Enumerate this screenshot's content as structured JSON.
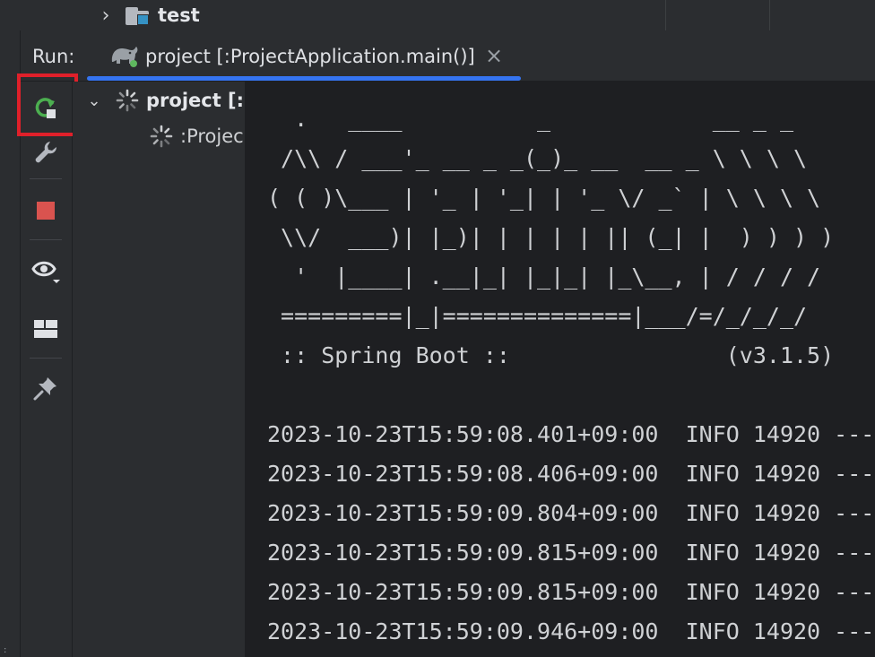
{
  "project_tree": {
    "folder_label": "test",
    "folder_icon": "folder-test-icon"
  },
  "run_panel": {
    "run_label": "Run:",
    "tab_label": "project [:ProjectApplication.main()]",
    "tab_close": "×",
    "tab_icon": "gradle-elephant-icon"
  },
  "toolbar": {
    "buttons": [
      "rerun-icon",
      "wrench-icon",
      "stop-icon",
      "eye-icon",
      "layout-icon",
      "pin-icon"
    ],
    "stop_color": "#d9534f",
    "rerun_color": "#4caf50",
    "highlight_color": "#e0202a"
  },
  "tree": {
    "root_label": "project [:l",
    "child_label": ":Projec"
  },
  "console": {
    "banner": [
      "  .   ____          _            __ _ _",
      " /\\\\ / ___'_ __ _ _(_)_ __  __ _ \\ \\ \\ \\",
      "( ( )\\___ | '_ | '_| | '_ \\/ _` | \\ \\ \\ \\",
      " \\\\/  ___)| |_)| | | | | || (_| |  ) ) ) )",
      "  '  |____| .__|_| |_|_| |_\\__, | / / / /",
      " =========|_|==============|___/=/_/_/_/",
      " :: Spring Boot ::                (v3.1.5)",
      ""
    ],
    "log_lines": [
      "2023-10-23T15:59:08.401+09:00  INFO 14920 ---",
      "2023-10-23T15:59:08.406+09:00  INFO 14920 ---",
      "2023-10-23T15:59:09.804+09:00  INFO 14920 ---",
      "2023-10-23T15:59:09.815+09:00  INFO 14920 ---",
      "2023-10-23T15:59:09.815+09:00  INFO 14920 ---",
      "2023-10-23T15:59:09.946+09:00  INFO 14920 ---"
    ]
  }
}
